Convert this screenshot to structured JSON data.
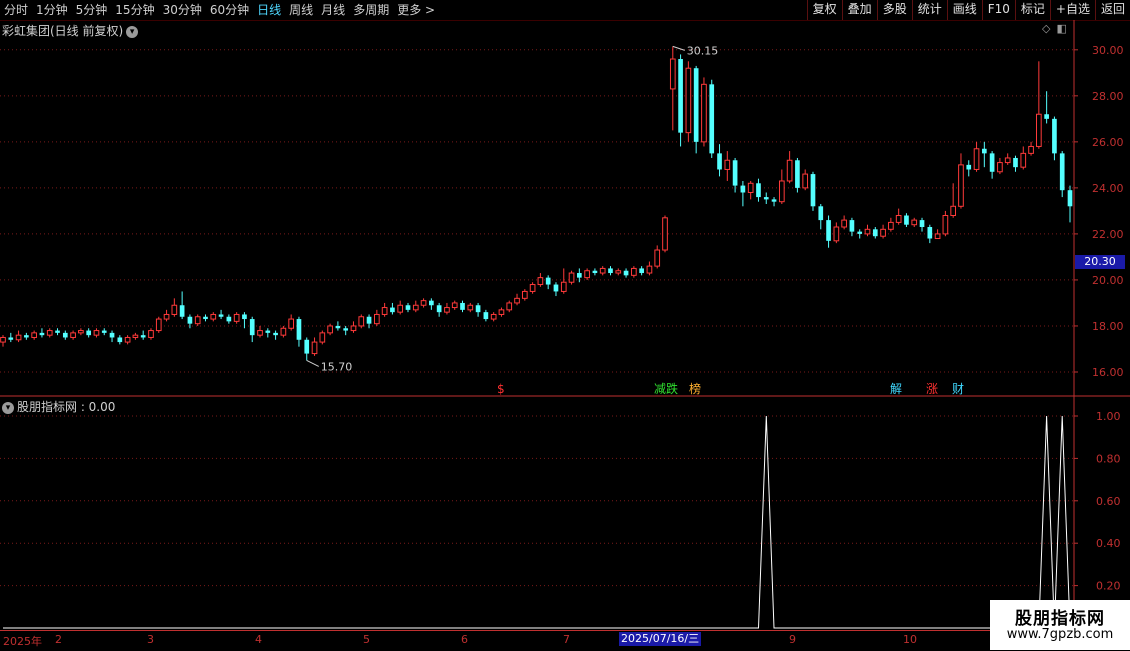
{
  "toolbar": {
    "periods": [
      "分时",
      "1分钟",
      "5分钟",
      "15分钟",
      "30分钟",
      "60分钟",
      "日线",
      "周线",
      "月线",
      "多周期",
      "更多 >"
    ],
    "active_period": "日线",
    "tools": [
      "复权",
      "叠加",
      "多股",
      "统计",
      "画线",
      "F10",
      "标记",
      "+自选",
      "返回"
    ]
  },
  "main_chart": {
    "title": "彩虹集团(日线 前复权)",
    "high_label": "30.15",
    "low_label": "15.70",
    "current_price_tag": "20.30",
    "y_ticks": [
      "30.00",
      "28.00",
      "26.00",
      "24.00",
      "22.00",
      "20.00",
      "18.00",
      "16.00"
    ],
    "markers": [
      {
        "text": "$",
        "color": "#ff3030"
      },
      {
        "text": "减跌",
        "color": "#30e030"
      },
      {
        "text": "榜",
        "color": "#ffb030"
      },
      {
        "text": "解",
        "color": "#40d8ff"
      },
      {
        "text": "涨",
        "color": "#ff3030"
      },
      {
        "text": "财",
        "color": "#40d8ff"
      }
    ]
  },
  "indicator": {
    "title": "股朋指标网 : 0.00",
    "y_ticks": [
      "1.00",
      "0.80",
      "0.60",
      "0.40",
      "0.20"
    ]
  },
  "date_axis": {
    "labels": [
      "2025年",
      "2",
      "3",
      "4",
      "5",
      "6",
      "7",
      "9",
      "10"
    ],
    "current": "2025/07/16/三"
  },
  "watermark": {
    "line1": "股朋指标网",
    "line2": "www.7gpzb.com"
  },
  "colors": {
    "up": "#ff3a3a",
    "down": "#54ffff",
    "grid": "#7a1a1a",
    "axis": "#c03030",
    "accent": "#4fd8ff"
  },
  "chart_data": {
    "type": "candlestick",
    "title": "彩虹集团(日线 前复权)",
    "ylim": [
      15,
      30.6
    ],
    "bars": [
      [
        17.3,
        17.5,
        17.6,
        17.1
      ],
      [
        17.5,
        17.4,
        17.7,
        17.3
      ],
      [
        17.4,
        17.6,
        17.8,
        17.3
      ],
      [
        17.6,
        17.5,
        17.7,
        17.4
      ],
      [
        17.5,
        17.7,
        17.8,
        17.4
      ],
      [
        17.7,
        17.6,
        17.9,
        17.5
      ],
      [
        17.6,
        17.8,
        17.9,
        17.5
      ],
      [
        17.8,
        17.7,
        17.9,
        17.6
      ],
      [
        17.7,
        17.5,
        17.8,
        17.4
      ],
      [
        17.5,
        17.7,
        17.8,
        17.4
      ],
      [
        17.7,
        17.8,
        17.9,
        17.6
      ],
      [
        17.8,
        17.6,
        17.9,
        17.5
      ],
      [
        17.6,
        17.8,
        17.9,
        17.5
      ],
      [
        17.8,
        17.7,
        17.9,
        17.6
      ],
      [
        17.7,
        17.5,
        17.8,
        17.3
      ],
      [
        17.5,
        17.3,
        17.6,
        17.2
      ],
      [
        17.3,
        17.5,
        17.6,
        17.2
      ],
      [
        17.5,
        17.6,
        17.7,
        17.4
      ],
      [
        17.6,
        17.5,
        17.8,
        17.4
      ],
      [
        17.5,
        17.8,
        17.9,
        17.4
      ],
      [
        17.8,
        18.3,
        18.4,
        17.7
      ],
      [
        18.3,
        18.5,
        18.7,
        18.2
      ],
      [
        18.5,
        18.9,
        19.2,
        18.4
      ],
      [
        18.9,
        18.4,
        19.5,
        18.3
      ],
      [
        18.4,
        18.1,
        18.5,
        17.9
      ],
      [
        18.1,
        18.4,
        18.5,
        18.0
      ],
      [
        18.4,
        18.3,
        18.5,
        18.2
      ],
      [
        18.3,
        18.5,
        18.6,
        18.2
      ],
      [
        18.5,
        18.4,
        18.7,
        18.3
      ],
      [
        18.4,
        18.2,
        18.5,
        18.1
      ],
      [
        18.2,
        18.5,
        18.6,
        18.1
      ],
      [
        18.5,
        18.3,
        18.6,
        17.9
      ],
      [
        18.3,
        17.6,
        18.4,
        17.3
      ],
      [
        17.6,
        17.8,
        18.0,
        17.5
      ],
      [
        17.8,
        17.7,
        17.9,
        17.5
      ],
      [
        17.7,
        17.6,
        17.8,
        17.4
      ],
      [
        17.6,
        17.9,
        18.0,
        17.5
      ],
      [
        17.9,
        18.3,
        18.5,
        17.8
      ],
      [
        18.3,
        17.4,
        18.4,
        17.1
      ],
      [
        17.4,
        16.8,
        17.5,
        16.5
      ],
      [
        16.8,
        17.3,
        17.5,
        16.7
      ],
      [
        17.3,
        17.7,
        17.8,
        17.2
      ],
      [
        17.7,
        18.0,
        18.1,
        17.6
      ],
      [
        18.0,
        17.9,
        18.2,
        17.8
      ],
      [
        17.9,
        17.8,
        18.0,
        17.6
      ],
      [
        17.8,
        18.0,
        18.2,
        17.7
      ],
      [
        18.0,
        18.4,
        18.5,
        17.9
      ],
      [
        18.4,
        18.1,
        18.5,
        17.9
      ],
      [
        18.1,
        18.5,
        18.7,
        18.0
      ],
      [
        18.5,
        18.8,
        19.0,
        18.4
      ],
      [
        18.8,
        18.6,
        19.0,
        18.5
      ],
      [
        18.6,
        18.9,
        19.1,
        18.5
      ],
      [
        18.9,
        18.7,
        19.0,
        18.6
      ],
      [
        18.7,
        18.9,
        19.1,
        18.6
      ],
      [
        18.9,
        19.1,
        19.2,
        18.8
      ],
      [
        19.1,
        18.9,
        19.2,
        18.7
      ],
      [
        18.9,
        18.6,
        19.0,
        18.4
      ],
      [
        18.6,
        18.8,
        19.0,
        18.5
      ],
      [
        18.8,
        19.0,
        19.1,
        18.7
      ],
      [
        19.0,
        18.7,
        19.1,
        18.6
      ],
      [
        18.7,
        18.9,
        19.0,
        18.6
      ],
      [
        18.9,
        18.6,
        19.0,
        18.4
      ],
      [
        18.6,
        18.3,
        18.7,
        18.2
      ],
      [
        18.3,
        18.5,
        18.6,
        18.2
      ],
      [
        18.5,
        18.7,
        18.8,
        18.4
      ],
      [
        18.7,
        19.0,
        19.1,
        18.6
      ],
      [
        19.0,
        19.2,
        19.4,
        18.9
      ],
      [
        19.2,
        19.5,
        19.6,
        19.1
      ],
      [
        19.5,
        19.8,
        19.9,
        19.4
      ],
      [
        19.8,
        20.1,
        20.3,
        19.7
      ],
      [
        20.1,
        19.8,
        20.2,
        19.6
      ],
      [
        19.8,
        19.5,
        19.9,
        19.3
      ],
      [
        19.5,
        19.9,
        20.5,
        19.4
      ],
      [
        19.9,
        20.3,
        20.4,
        19.8
      ],
      [
        20.3,
        20.1,
        20.5,
        19.9
      ],
      [
        20.1,
        20.4,
        20.5,
        20.0
      ],
      [
        20.4,
        20.3,
        20.5,
        20.2
      ],
      [
        20.3,
        20.5,
        20.6,
        20.2
      ],
      [
        20.5,
        20.3,
        20.6,
        20.2
      ],
      [
        20.3,
        20.4,
        20.5,
        20.2
      ],
      [
        20.4,
        20.2,
        20.5,
        20.1
      ],
      [
        20.2,
        20.5,
        20.6,
        20.1
      ],
      [
        20.5,
        20.3,
        20.6,
        20.2
      ],
      [
        20.3,
        20.6,
        20.8,
        20.2
      ],
      [
        20.6,
        21.3,
        21.5,
        20.5
      ],
      [
        21.3,
        22.7,
        22.8,
        21.2
      ],
      [
        28.3,
        29.6,
        30.15,
        26.5
      ],
      [
        29.6,
        26.4,
        29.8,
        25.8
      ],
      [
        26.4,
        29.2,
        29.5,
        26.0
      ],
      [
        29.2,
        26.0,
        29.3,
        25.5
      ],
      [
        26.0,
        28.5,
        28.8,
        25.8
      ],
      [
        28.5,
        25.5,
        28.7,
        25.3
      ],
      [
        25.5,
        24.8,
        25.9,
        24.5
      ],
      [
        24.8,
        25.2,
        25.6,
        24.3
      ],
      [
        25.2,
        24.1,
        25.3,
        23.8
      ],
      [
        24.1,
        23.8,
        24.3,
        23.2
      ],
      [
        23.8,
        24.2,
        24.3,
        23.5
      ],
      [
        24.2,
        23.6,
        24.4,
        23.4
      ],
      [
        23.6,
        23.5,
        23.8,
        23.3
      ],
      [
        23.5,
        23.4,
        23.6,
        23.2
      ],
      [
        23.4,
        24.3,
        24.8,
        23.3
      ],
      [
        24.3,
        25.2,
        25.6,
        24.2
      ],
      [
        25.2,
        24.0,
        25.3,
        23.8
      ],
      [
        24.0,
        24.6,
        24.8,
        23.9
      ],
      [
        24.6,
        23.2,
        24.7,
        23.0
      ],
      [
        23.2,
        22.6,
        23.3,
        22.2
      ],
      [
        22.6,
        21.7,
        22.8,
        21.4
      ],
      [
        21.7,
        22.3,
        22.5,
        21.6
      ],
      [
        22.3,
        22.6,
        22.8,
        22.2
      ],
      [
        22.6,
        22.1,
        22.7,
        21.9
      ],
      [
        22.1,
        22.0,
        22.2,
        21.8
      ],
      [
        22.0,
        22.2,
        22.4,
        21.9
      ],
      [
        22.2,
        21.9,
        22.3,
        21.8
      ],
      [
        21.9,
        22.2,
        22.4,
        21.8
      ],
      [
        22.2,
        22.5,
        22.7,
        22.1
      ],
      [
        22.5,
        22.8,
        23.1,
        22.4
      ],
      [
        22.8,
        22.4,
        22.9,
        22.3
      ],
      [
        22.4,
        22.6,
        22.7,
        22.3
      ],
      [
        22.6,
        22.3,
        22.7,
        22.1
      ],
      [
        22.3,
        21.8,
        22.4,
        21.6
      ],
      [
        21.8,
        22.0,
        22.2,
        21.8
      ],
      [
        22.0,
        22.8,
        23.0,
        21.9
      ],
      [
        22.8,
        23.2,
        24.2,
        22.7
      ],
      [
        23.2,
        25.0,
        25.5,
        23.1
      ],
      [
        25.0,
        24.8,
        25.2,
        24.5
      ],
      [
        24.8,
        25.7,
        26.0,
        24.7
      ],
      [
        25.7,
        25.5,
        26.0,
        24.9
      ],
      [
        25.5,
        24.7,
        25.6,
        24.4
      ],
      [
        24.7,
        25.1,
        25.3,
        24.6
      ],
      [
        25.1,
        25.3,
        25.5,
        25.0
      ],
      [
        25.3,
        24.9,
        25.4,
        24.7
      ],
      [
        24.9,
        25.5,
        25.8,
        24.8
      ],
      [
        25.5,
        25.8,
        26.0,
        25.4
      ],
      [
        25.8,
        27.2,
        29.5,
        25.7
      ],
      [
        27.2,
        27.0,
        28.2,
        26.8
      ],
      [
        27.0,
        25.5,
        27.1,
        25.2
      ],
      [
        25.5,
        23.9,
        25.6,
        23.6
      ],
      [
        23.9,
        23.2,
        24.1,
        22.5
      ]
    ],
    "indicator_series": {
      "name": "股朋指标网",
      "peaks_at_bars": [
        98,
        134,
        136
      ],
      "peak_value": 1.0
    }
  }
}
